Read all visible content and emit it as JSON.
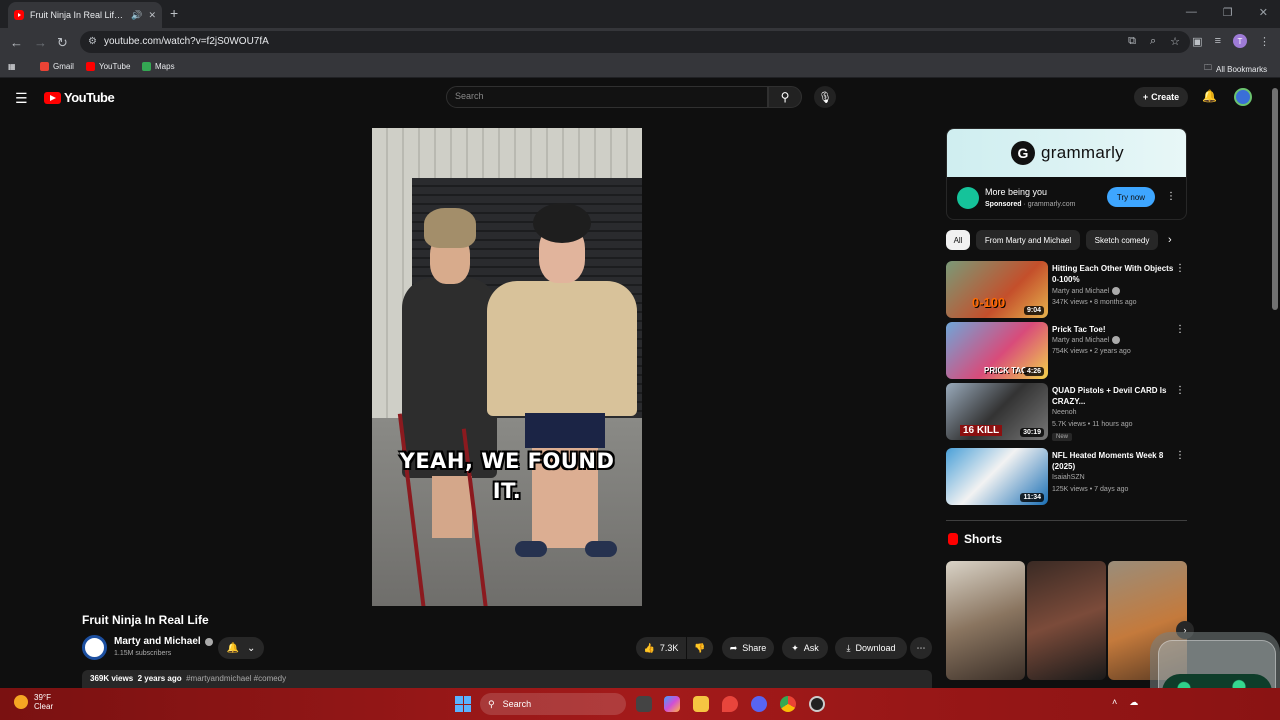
{
  "browser": {
    "tab_title": "Fruit Ninja In Real Life - YouTube",
    "url": "youtube.com/watch?v=f2jS0WOU7fA",
    "bookmarks": [
      "Gmail",
      "YouTube",
      "Maps"
    ],
    "all_bookmarks": "All Bookmarks",
    "profile_initial": "T"
  },
  "youtube": {
    "logo_text": "YouTube",
    "search_placeholder": "Search",
    "create_label": "Create"
  },
  "video": {
    "caption_line1": "YEAH, WE FOUND",
    "caption_line2": "IT.",
    "title": "Fruit Ninja In Real Life",
    "channel": "Marty and Michael",
    "subscribers": "1.15M subscribers",
    "likes": "7.3K",
    "share_label": "Share",
    "ask_label": "Ask",
    "download_label": "Download",
    "views": "369K views",
    "age": "2 years ago",
    "hashtags": "#martyandmichael #comedy"
  },
  "ad": {
    "brand": "grammarly",
    "title": "More being you",
    "sponsored": "Sponsored",
    "domain": "grammarly.com",
    "cta": "Try now"
  },
  "chips": [
    "All",
    "From Marty and Michael",
    "Sketch comedy"
  ],
  "recommendations": [
    {
      "title": "Hitting Each Other With Objects 0-100%",
      "channel": "Marty and Michael",
      "verified": true,
      "meta": "347K views • 8 months ago",
      "duration": "9:04",
      "thumb_text": "0-100",
      "badge": ""
    },
    {
      "title": "Prick Tac Toe!",
      "channel": "Marty and Michael",
      "verified": true,
      "meta": "754K views • 2 years ago",
      "duration": "4:26",
      "thumb_text": "PRICK TAC",
      "badge": ""
    },
    {
      "title": "QUAD Pistols + Devil CARD Is CRAZY...",
      "channel": "Neenoh",
      "verified": false,
      "meta": "5.7K views • 11 hours ago",
      "duration": "30:19",
      "thumb_text": "16 KILL",
      "badge": "New"
    },
    {
      "title": "NFL Heated Moments Week 8 (2025)",
      "channel": "IsaiahSZN",
      "verified": false,
      "meta": "125K views • 7 days ago",
      "duration": "11:34",
      "thumb_text": "",
      "badge": ""
    }
  ],
  "shorts_heading": "Shorts",
  "taskbar": {
    "temp": "39°F",
    "condition": "Clear",
    "search_label": "Search"
  },
  "colors": {
    "yt_red": "#ff0000",
    "bg": "#0f0f0f",
    "accent_blue": "#3ea6ff",
    "taskbar_red": "#a31a1a"
  }
}
